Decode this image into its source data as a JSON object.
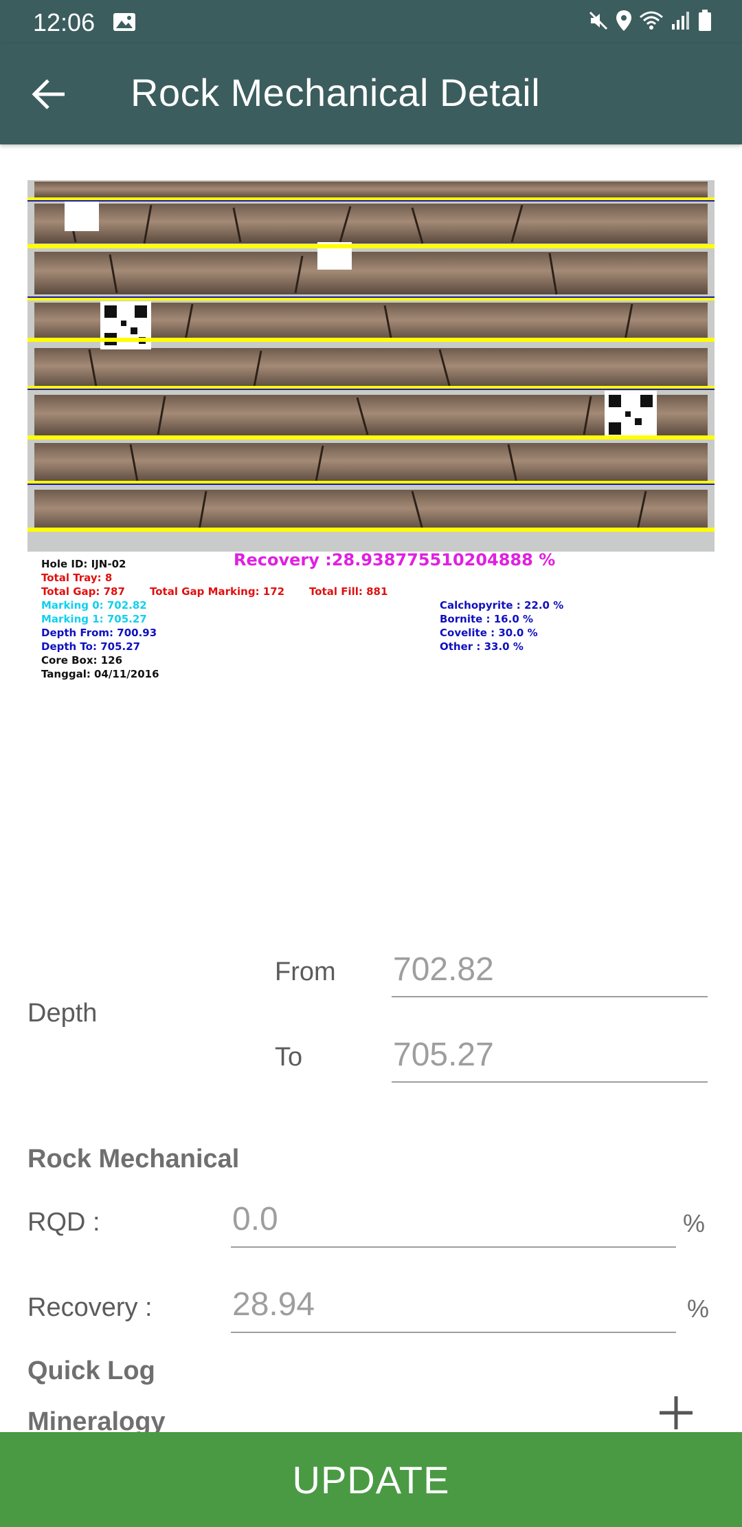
{
  "status_bar": {
    "time": "12:06",
    "icons": [
      "image-icon",
      "mute-icon",
      "location-icon",
      "wifi-icon",
      "signal-icon",
      "battery-icon"
    ]
  },
  "app_bar": {
    "title": "Rock Mechanical Detail",
    "back_icon": "arrow-left-icon",
    "background": "#3c5d5d"
  },
  "core_photo": {
    "overlay": {
      "hole_id": "Hole ID:   IJN-02",
      "total_tray": "Total Tray:   8",
      "total_gap": "Total Gap:   787",
      "total_gap_marking": "Total Gap Marking:    172",
      "total_fill": "Total Fill:    881",
      "marking_0": "Marking 0:    702.82",
      "marking_1": "Marking 1:    705.27",
      "depth_from": "Depth From:   700.93",
      "depth_to": "Depth To:   705.27",
      "core_box": "Core Box:   126",
      "tanggal": "Tanggal:   04/11/2016",
      "recovery": "Recovery    :28.938775510204888  %",
      "minerals": [
        "Calchopyrite   :   22.0 %",
        "Bornite   :   16.0 %",
        "Covelite   :   30.0 %",
        "Other   :   33.0 %"
      ]
    }
  },
  "depth": {
    "label": "Depth",
    "from_label": "From",
    "from_value": "702.82",
    "to_label": "To",
    "to_value": "705.27"
  },
  "rock_mechanical": {
    "title": "Rock Mechanical",
    "rqd_label": "RQD :",
    "rqd_value": "0.0",
    "rqd_unit": "%",
    "recovery_label": "Recovery :",
    "recovery_value": "28.94",
    "recovery_unit": "%"
  },
  "quick_log": {
    "title": "Quick Log",
    "mineralogy_label": "Mineralogy",
    "add_icon": "plus-icon"
  },
  "update_button": {
    "label": "UPDATE",
    "color": "#4a9a44"
  }
}
